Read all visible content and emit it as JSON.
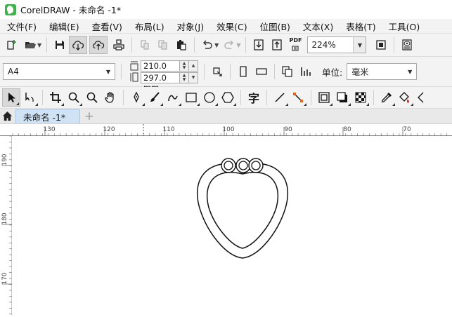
{
  "window": {
    "title": "CorelDRAW - 未命名 -1*"
  },
  "menu": [
    {
      "label": "文件(F)",
      "name": "menu-file"
    },
    {
      "label": "编辑(E)",
      "name": "menu-edit"
    },
    {
      "label": "查看(V)",
      "name": "menu-view"
    },
    {
      "label": "布局(L)",
      "name": "menu-layout"
    },
    {
      "label": "对象(J)",
      "name": "menu-object"
    },
    {
      "label": "效果(C)",
      "name": "menu-effects"
    },
    {
      "label": "位图(B)",
      "name": "menu-bitmaps"
    },
    {
      "label": "文本(X)",
      "name": "menu-text"
    },
    {
      "label": "表格(T)",
      "name": "menu-table"
    },
    {
      "label": "工具(O)",
      "name": "menu-tools"
    }
  ],
  "standard_toolbar": {
    "icons": [
      "new-document-icon",
      "open-folder-icon",
      "save-icon",
      "cloud-download-icon",
      "cloud-upload-icon",
      "print-icon",
      "cut-icon",
      "copy-icon",
      "paste-icon",
      "undo-icon",
      "redo-icon",
      "import-icon",
      "export-icon",
      "pdf-icon",
      "full-screen-icon",
      "view-options-icon"
    ],
    "pdf_label": "PDF",
    "zoom_value": "224%"
  },
  "property_bar": {
    "page_size": "A4",
    "width_value": "210.0 mm",
    "height_value": "297.0 mm",
    "unit_label": "单位:",
    "unit_value": "毫米"
  },
  "toolbox_icons": [
    "pick-tool-icon",
    "shape-tool-icon",
    "crop-tool-icon",
    "zoom-tool-icon",
    "zoom-out-icon",
    "pan-tool-icon",
    "pen-tool-icon",
    "brush-tool-icon",
    "bezier-tool-icon",
    "rectangle-tool-icon",
    "ellipse-tool-icon",
    "polygon-tool-icon",
    "text-tool-icon",
    "line-tool-icon",
    "connector-tool-icon",
    "contour-tool-icon",
    "shadow-tool-icon",
    "transparency-tool-icon",
    "eyedropper-tool-icon",
    "fill-tool-icon",
    "outline-tool-icon"
  ],
  "text_tool_glyph": "字",
  "tabs": {
    "active_label": "未命名 -1*",
    "add_label": "+"
  },
  "rulers": {
    "horizontal_labels": [
      "130",
      "120",
      "110",
      "100",
      "90",
      "80",
      "70"
    ],
    "vertical_labels": [
      "190",
      "180",
      "170"
    ]
  },
  "colors": {
    "accent": "#2a9d9b",
    "tab_active": "#cfe3f5",
    "chrome": "#f3f3f3",
    "logo": "#3cb34a"
  }
}
